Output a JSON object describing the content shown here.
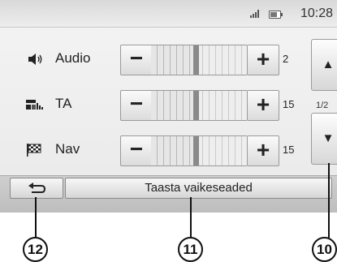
{
  "status": {
    "time": "10:28"
  },
  "rows": [
    {
      "label": "Audio",
      "value": "2",
      "icon": "speaker-icon",
      "level": 0.5
    },
    {
      "label": "TA",
      "value": "15",
      "icon": "traffic-info-icon",
      "level": 0.5
    },
    {
      "label": "Nav",
      "value": "15",
      "icon": "checkered-flag-icon",
      "level": 0.5
    }
  ],
  "controls": {
    "minus": "−",
    "plus": "+"
  },
  "scroll": {
    "up": "▲",
    "down": "▼",
    "page": "1/2"
  },
  "bottom": {
    "reset_label": "Taasta vaikeseaded"
  },
  "callouts": {
    "back": "12",
    "reset": "11",
    "scroll": "10"
  }
}
